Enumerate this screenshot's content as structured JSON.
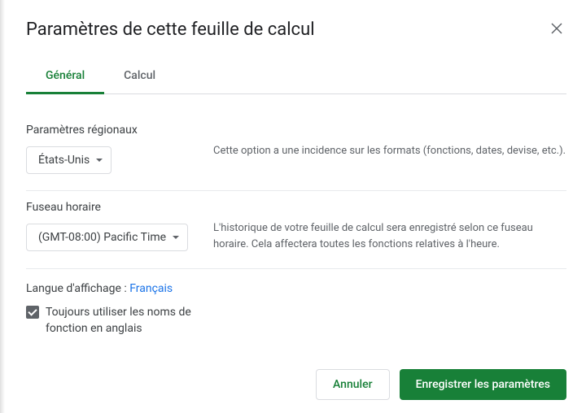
{
  "dialog": {
    "title": "Paramètres de cette feuille de calcul"
  },
  "tabs": {
    "general": "Général",
    "calc": "Calcul"
  },
  "locale": {
    "label": "Paramètres régionaux",
    "value": "États-Unis",
    "description": "Cette option a une incidence sur les formats (fonctions, dates, devise, etc.)."
  },
  "timezone": {
    "label": "Fuseau horaire",
    "value": "(GMT-08:00) Pacific Time",
    "description": "L'historique de votre feuille de calcul sera enregistré selon ce fuseau horaire. Cela affectera toutes les fonctions relatives à l'heure."
  },
  "language": {
    "label": "Langue d'affichage : ",
    "value": "Français",
    "checkbox_label": "Toujours utiliser les noms de fonction en anglais",
    "checked": true
  },
  "footer": {
    "cancel": "Annuler",
    "save": "Enregistrer les paramètres"
  }
}
